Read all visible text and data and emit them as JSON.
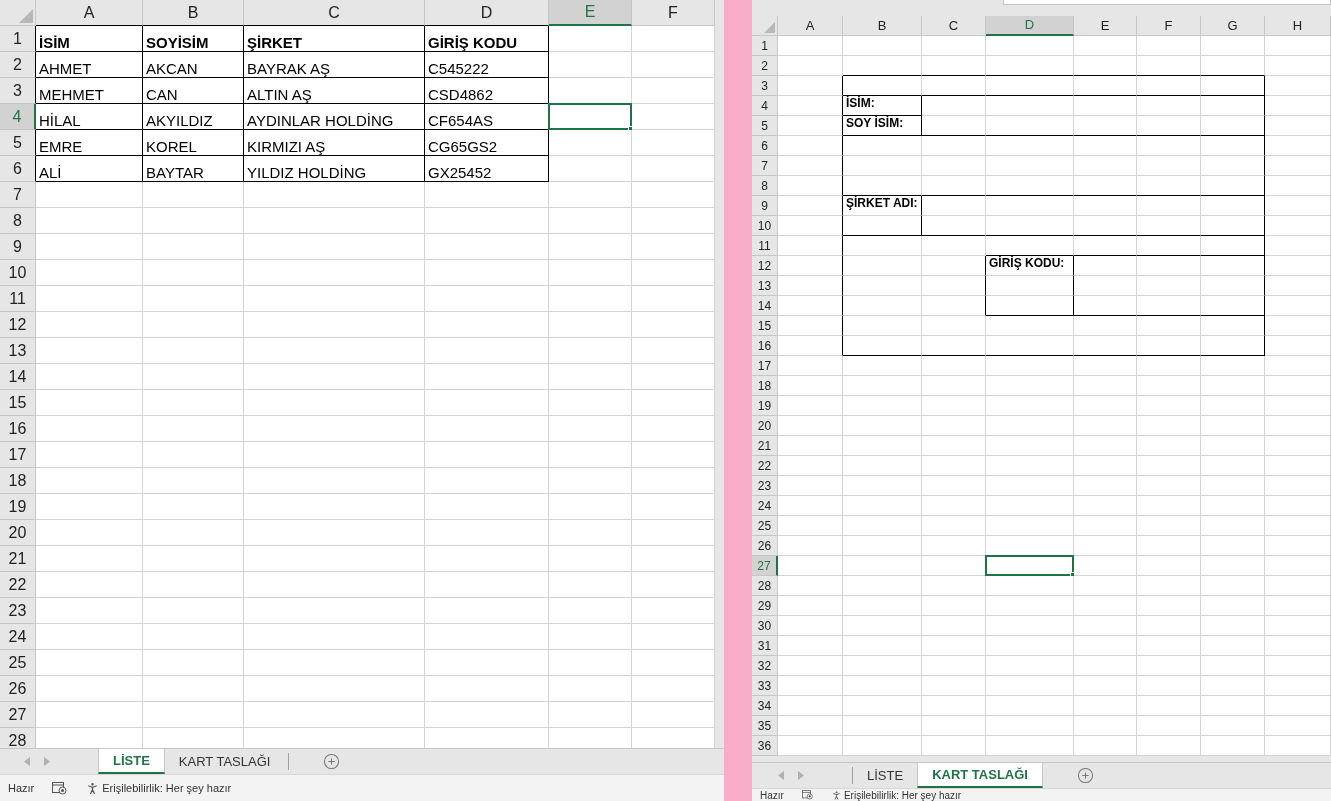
{
  "left_window": {
    "column_headers": [
      {
        "label": "A",
        "selected": false
      },
      {
        "label": "B",
        "selected": false
      },
      {
        "label": "C",
        "selected": false
      },
      {
        "label": "D",
        "selected": false
      },
      {
        "label": "E",
        "selected": true
      },
      {
        "label": "F",
        "selected": false
      }
    ],
    "row_headers": [
      {
        "label": "1",
        "selected": false
      },
      {
        "label": "2",
        "selected": false
      },
      {
        "label": "3",
        "selected": false
      },
      {
        "label": "4",
        "selected": true
      },
      {
        "label": "5",
        "selected": false
      },
      {
        "label": "6",
        "selected": false
      },
      {
        "label": "7",
        "selected": false
      },
      {
        "label": "8",
        "selected": false
      },
      {
        "label": "9",
        "selected": false
      },
      {
        "label": "10",
        "selected": false
      },
      {
        "label": "11",
        "selected": false
      },
      {
        "label": "12",
        "selected": false
      },
      {
        "label": "13",
        "selected": false
      },
      {
        "label": "14",
        "selected": false
      },
      {
        "label": "15",
        "selected": false
      },
      {
        "label": "16",
        "selected": false
      },
      {
        "label": "17",
        "selected": false
      },
      {
        "label": "18",
        "selected": false
      },
      {
        "label": "19",
        "selected": false
      },
      {
        "label": "20",
        "selected": false
      },
      {
        "label": "21",
        "selected": false
      },
      {
        "label": "22",
        "selected": false
      },
      {
        "label": "23",
        "selected": false
      },
      {
        "label": "24",
        "selected": false
      },
      {
        "label": "25",
        "selected": false
      },
      {
        "label": "26",
        "selected": false
      },
      {
        "label": "27",
        "selected": false
      },
      {
        "label": "28",
        "selected": false
      }
    ],
    "rows": [
      {
        "kind": "header",
        "cells": [
          "İSİM",
          "SOYİSİM",
          "ŞİRKET",
          "GİRİŞ KODU"
        ]
      },
      {
        "kind": "data",
        "cells": [
          "AHMET",
          "AKCAN",
          "BAYRAK AŞ",
          "C545222"
        ]
      },
      {
        "kind": "data",
        "cells": [
          "MEHMET",
          "CAN",
          "ALTIN AŞ",
          "CSD4862"
        ]
      },
      {
        "kind": "data",
        "cells": [
          "HİLAL",
          "AKYILDIZ",
          "AYDINLAR HOLDİNG",
          "CF654AS"
        ]
      },
      {
        "kind": "data",
        "cells": [
          "EMRE",
          "KOREL",
          "KIRMIZI AŞ",
          "CG65GS2"
        ]
      },
      {
        "kind": "data",
        "cells": [
          "ALİ",
          "BAYTAR",
          "YILDIZ HOLDİNG",
          "GX25452"
        ]
      }
    ],
    "sheet_tabs": [
      {
        "label": "LİSTE",
        "selected": true
      },
      {
        "label": "KART TASLAĞI",
        "selected": false
      }
    ],
    "status_bar": {
      "mode": "Hazır",
      "accessibility": "Erişilebilirlik: Her şey hazır"
    }
  },
  "right_window": {
    "column_headers": [
      {
        "label": "A",
        "selected": false
      },
      {
        "label": "B",
        "selected": false
      },
      {
        "label": "C",
        "selected": false
      },
      {
        "label": "D",
        "selected": true
      },
      {
        "label": "E",
        "selected": false
      },
      {
        "label": "F",
        "selected": false
      },
      {
        "label": "G",
        "selected": false
      },
      {
        "label": "H",
        "selected": false
      }
    ],
    "row_headers": [
      {
        "label": "1",
        "selected": false
      },
      {
        "label": "2",
        "selected": false
      },
      {
        "label": "3",
        "selected": false
      },
      {
        "label": "4",
        "selected": false
      },
      {
        "label": "5",
        "selected": false
      },
      {
        "label": "6",
        "selected": false
      },
      {
        "label": "7",
        "selected": false
      },
      {
        "label": "8",
        "selected": false
      },
      {
        "label": "9",
        "selected": false
      },
      {
        "label": "10",
        "selected": false
      },
      {
        "label": "11",
        "selected": false
      },
      {
        "label": "12",
        "selected": false
      },
      {
        "label": "13",
        "selected": false
      },
      {
        "label": "14",
        "selected": false
      },
      {
        "label": "15",
        "selected": false
      },
      {
        "label": "16",
        "selected": false
      },
      {
        "label": "17",
        "selected": false
      },
      {
        "label": "18",
        "selected": false
      },
      {
        "label": "19",
        "selected": false
      },
      {
        "label": "20",
        "selected": false
      },
      {
        "label": "21",
        "selected": false
      },
      {
        "label": "22",
        "selected": false
      },
      {
        "label": "23",
        "selected": false
      },
      {
        "label": "24",
        "selected": false
      },
      {
        "label": "25",
        "selected": false
      },
      {
        "label": "26",
        "selected": false
      },
      {
        "label": "27",
        "selected": true
      },
      {
        "label": "28",
        "selected": false
      },
      {
        "label": "29",
        "selected": false
      },
      {
        "label": "30",
        "selected": false
      },
      {
        "label": "31",
        "selected": false
      },
      {
        "label": "32",
        "selected": false
      },
      {
        "label": "33",
        "selected": false
      },
      {
        "label": "34",
        "selected": false
      },
      {
        "label": "35",
        "selected": false
      },
      {
        "label": "36",
        "selected": false
      }
    ],
    "card_labels": [
      "İSİM:",
      "SOY İSİM:",
      "ŞİRKET ADI:",
      "GİRİŞ KODU:"
    ],
    "sheet_tabs": [
      {
        "label": "LİSTE",
        "selected": false
      },
      {
        "label": "KART TASLAĞI",
        "selected": true
      }
    ],
    "status_bar": {
      "mode": "Hazır",
      "accessibility": "Erişilebilirlik: Her şey hazır"
    }
  }
}
